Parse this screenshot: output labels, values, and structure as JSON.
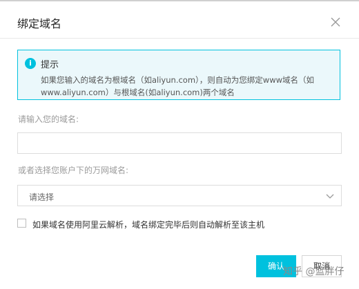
{
  "dialog": {
    "title": "绑定域名",
    "close_icon": "close-icon"
  },
  "notice": {
    "icon": "info-icon",
    "icon_glyph": "i",
    "title": "提示",
    "body": "如果您输入的域名为根域名（如aliyun.com），则自动为您绑定www域名（如www.aliyun.com）与根域名(如aliyun.com)两个域名"
  },
  "domain_input": {
    "label": "请输入您的域名:",
    "value": "",
    "placeholder": ""
  },
  "account_domain": {
    "label": "或者选择您账户下的万网域名:",
    "selected": "请选择"
  },
  "auto_parse": {
    "checked": false,
    "label": "如果域名使用阿里云解析，域名绑定完毕后则自动解析至该主机"
  },
  "buttons": {
    "confirm": "确认",
    "cancel": "取消"
  },
  "watermark": "知乎 @蓝胖仔",
  "colors": {
    "accent": "#00c1de",
    "notice_bg": "#ebf8fb"
  }
}
